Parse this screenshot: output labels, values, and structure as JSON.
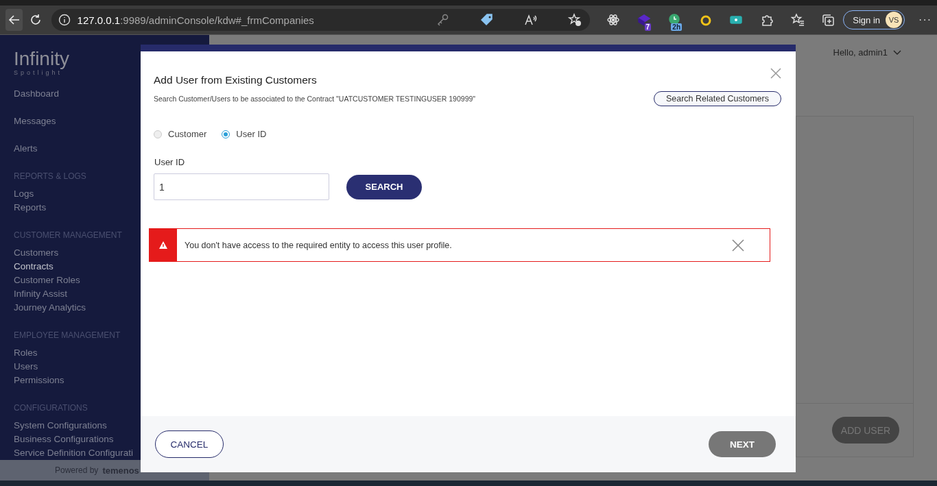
{
  "browser": {
    "url_host": "127.0.0.1",
    "url_path": ":9989/adminConsole/kdw#_frmCompanies",
    "extension_badges": [
      "7",
      "2h"
    ],
    "sign_in": "Sign in",
    "avatar": "VS",
    "more": "···"
  },
  "sidebar": {
    "logo": "Infinity",
    "logo_sub": "Spotlight",
    "groups": [
      {
        "items": [
          {
            "label": "Dashboard",
            "selected": false
          }
        ]
      },
      {
        "items": [
          {
            "label": "Messages",
            "selected": false
          }
        ]
      },
      {
        "items": [
          {
            "label": "Alerts",
            "selected": false
          }
        ]
      },
      {
        "heading": "REPORTS & LOGS",
        "items": [
          {
            "label": "Logs",
            "selected": false
          },
          {
            "label": "Reports",
            "selected": false
          }
        ]
      },
      {
        "heading": "CUSTOMER MANAGEMENT",
        "items": [
          {
            "label": "Customers",
            "selected": false
          },
          {
            "label": "Contracts",
            "selected": true
          },
          {
            "label": "Customer Roles",
            "selected": false
          },
          {
            "label": "Infinity Assist",
            "selected": false
          },
          {
            "label": "Journey Analytics",
            "selected": false
          }
        ]
      },
      {
        "heading": "EMPLOYEE MANAGEMENT",
        "items": [
          {
            "label": "Roles",
            "selected": false
          },
          {
            "label": "Users",
            "selected": false
          },
          {
            "label": "Permissions",
            "selected": false
          }
        ]
      },
      {
        "heading": "CONFIGURATIONS",
        "items": [
          {
            "label": "System Configurations",
            "selected": false
          },
          {
            "label": "Business Configurations",
            "selected": false
          },
          {
            "label": "Service Definition Configurati",
            "selected": false
          }
        ]
      }
    ],
    "footer_label": "Powered by",
    "footer_brand": "temenos"
  },
  "header": {
    "greeting": "Hello, admin1"
  },
  "background_card": {
    "button": "ADD USER"
  },
  "dialog": {
    "title": "Add User from Existing Customers",
    "subtitle": "Search Customer/Users to be associated to the Contract \"UATCUSTOMER TESTINGUSER 190999\"",
    "related_button": "Search Related Customers",
    "options": [
      {
        "label": "Customer",
        "selected": false
      },
      {
        "label": "User ID",
        "selected": true
      }
    ],
    "field_label": "User ID",
    "field_value": "1",
    "search_button": "SEARCH",
    "error": "You don't have access to the required entity to access this user profile.",
    "cancel_button": "CANCEL",
    "next_button": "NEXT"
  }
}
